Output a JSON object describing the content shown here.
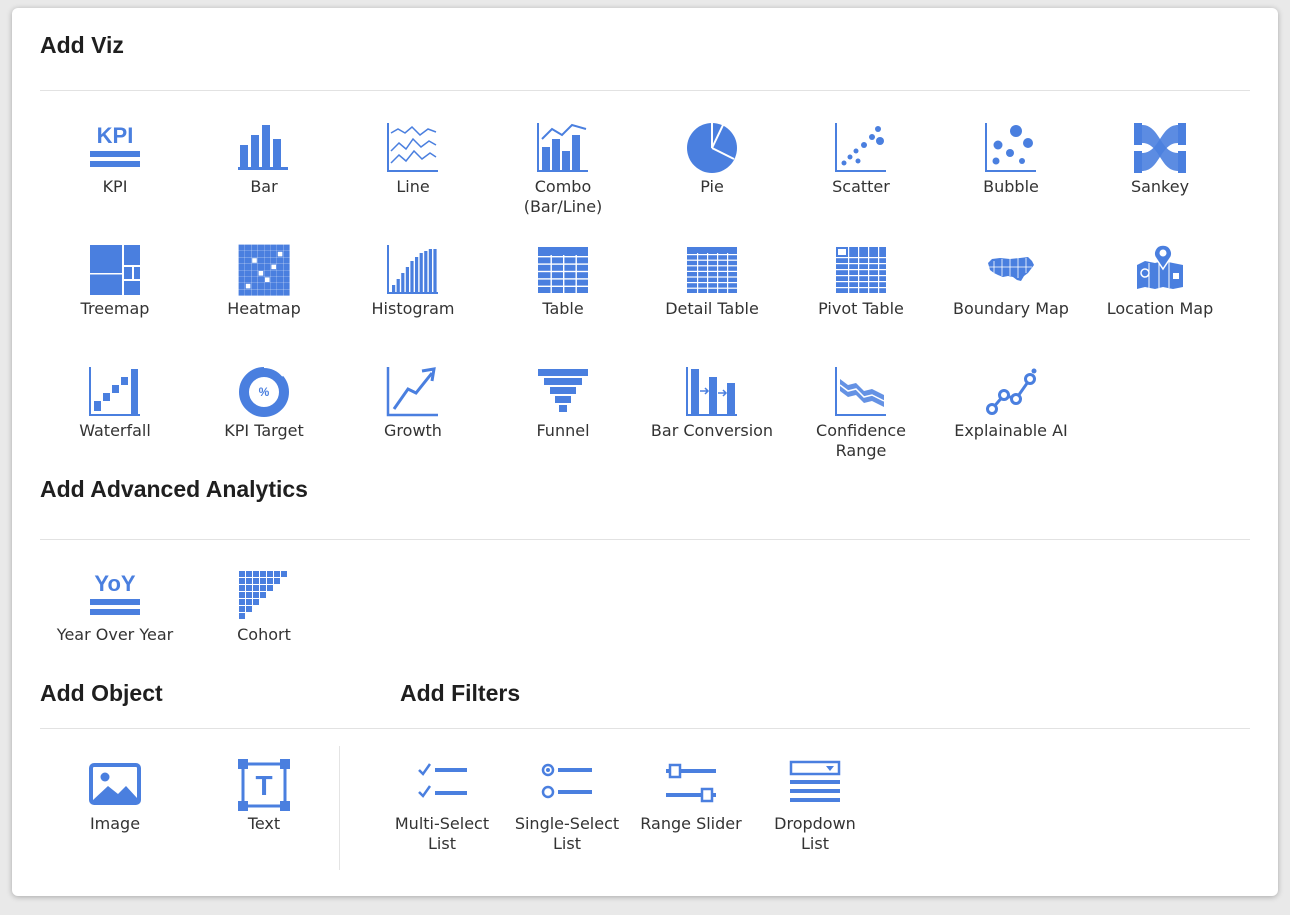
{
  "colors": {
    "icon": "#4a7fdf",
    "text": "#333333",
    "heading": "#1f1f1f"
  },
  "sections": {
    "viz": {
      "title": "Add Viz"
    },
    "advanced": {
      "title": "Add Advanced Analytics"
    },
    "object": {
      "title": "Add Object"
    },
    "filters": {
      "title": "Add Filters"
    }
  },
  "viz": [
    {
      "label": "KPI",
      "icon": "kpi-icon"
    },
    {
      "label": "Bar",
      "icon": "bar-chart-icon"
    },
    {
      "label": "Line",
      "icon": "line-chart-icon"
    },
    {
      "label": "Combo\n(Bar/Line)",
      "icon": "combo-chart-icon"
    },
    {
      "label": "Pie",
      "icon": "pie-chart-icon"
    },
    {
      "label": "Scatter",
      "icon": "scatter-chart-icon"
    },
    {
      "label": "Bubble",
      "icon": "bubble-chart-icon"
    },
    {
      "label": "Sankey",
      "icon": "sankey-chart-icon"
    },
    {
      "label": "Treemap",
      "icon": "treemap-icon"
    },
    {
      "label": "Heatmap",
      "icon": "heatmap-icon"
    },
    {
      "label": "Histogram",
      "icon": "histogram-icon"
    },
    {
      "label": "Table",
      "icon": "table-icon"
    },
    {
      "label": "Detail Table",
      "icon": "detail-table-icon"
    },
    {
      "label": "Pivot Table",
      "icon": "pivot-table-icon"
    },
    {
      "label": "Boundary Map",
      "icon": "boundary-map-icon"
    },
    {
      "label": "Location Map",
      "icon": "location-map-icon"
    },
    {
      "label": "Waterfall",
      "icon": "waterfall-chart-icon"
    },
    {
      "label": "KPI Target",
      "icon": "kpi-target-icon"
    },
    {
      "label": "Growth",
      "icon": "growth-chart-icon"
    },
    {
      "label": "Funnel",
      "icon": "funnel-chart-icon"
    },
    {
      "label": "Bar Conversion",
      "icon": "bar-conversion-icon"
    },
    {
      "label": "Confidence\nRange",
      "icon": "confidence-range-icon"
    },
    {
      "label": "Explainable AI",
      "icon": "explainable-ai-icon"
    }
  ],
  "advanced": [
    {
      "label": "Year Over Year",
      "icon": "yoy-icon"
    },
    {
      "label": "Cohort",
      "icon": "cohort-icon"
    }
  ],
  "objects": [
    {
      "label": "Image",
      "icon": "image-icon"
    },
    {
      "label": "Text",
      "icon": "text-box-icon"
    }
  ],
  "filters": [
    {
      "label": "Multi-Select\nList",
      "icon": "multi-select-list-icon"
    },
    {
      "label": "Single-Select\nList",
      "icon": "single-select-list-icon"
    },
    {
      "label": "Range Slider",
      "icon": "range-slider-icon"
    },
    {
      "label": "Dropdown\nList",
      "icon": "dropdown-list-icon"
    }
  ],
  "icon_glyphs": {
    "kpi_text": "KPI",
    "yoy_text": "YoY",
    "percent_text": "%",
    "text_tool_text": "T"
  }
}
